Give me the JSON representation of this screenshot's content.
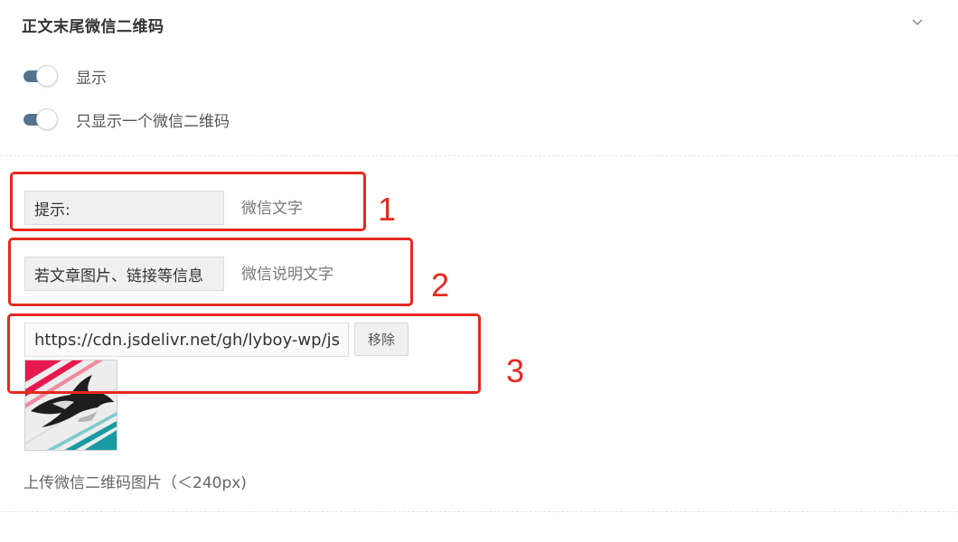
{
  "section": {
    "title": "正文末尾微信二维码",
    "collapse_icon": "chevron-down-icon"
  },
  "toggles": [
    {
      "label": "显示",
      "on": true
    },
    {
      "label": "只显示一个微信二维码",
      "on": true
    }
  ],
  "fields": {
    "wechat_text": {
      "value": "提示:",
      "desc": "微信文字"
    },
    "wechat_desc": {
      "value": "若文章图片、链接等信息",
      "desc": "微信说明文字"
    },
    "qr_image": {
      "url": "https://cdn.jsdelivr.net/gh/lyboy-wp/jscdn",
      "remove_label": "移除",
      "preview_icon": "qr-code-image",
      "desc": "上传微信二维码图片（＜240px)"
    }
  },
  "annotations": [
    "1",
    "2",
    "3"
  ],
  "colors": {
    "toggle_on": "#53748f",
    "annotation_red": "#e52a20"
  }
}
